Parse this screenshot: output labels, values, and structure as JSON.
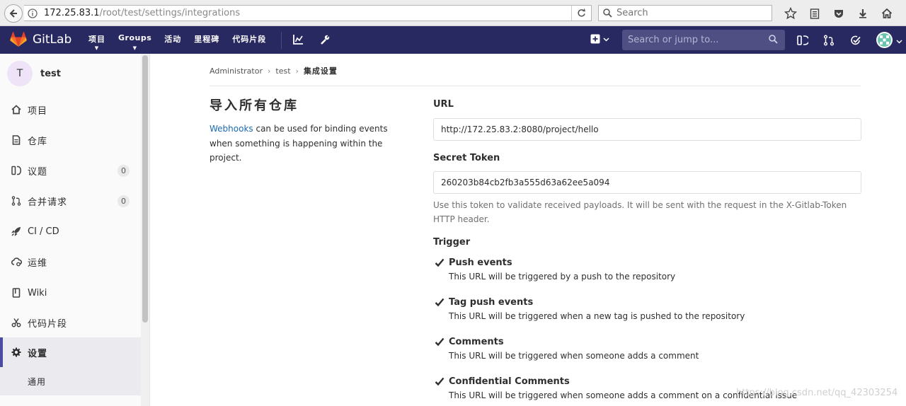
{
  "browser": {
    "url_host": "172.25.83.1",
    "url_path": "/root/test/settings/integrations",
    "search_placeholder": "Search"
  },
  "header": {
    "brand": "GitLab",
    "nav": [
      "项目",
      "Groups",
      "活动",
      "里程碑",
      "代码片段"
    ],
    "search_placeholder": "Search or jump to..."
  },
  "sidebar": {
    "project_initial": "T",
    "project_name": "test",
    "items": [
      {
        "label": "项目",
        "icon": "home-icon"
      },
      {
        "label": "仓库",
        "icon": "doc-icon"
      },
      {
        "label": "议题",
        "icon": "issues-icon",
        "count": "0"
      },
      {
        "label": "合并请求",
        "icon": "merge-icon",
        "count": "0"
      },
      {
        "label": "CI / CD",
        "icon": "rocket-icon"
      },
      {
        "label": "运维",
        "icon": "cloud-icon"
      },
      {
        "label": "Wiki",
        "icon": "book-icon"
      },
      {
        "label": "代码片段",
        "icon": "scissors-icon"
      },
      {
        "label": "设置",
        "icon": "gear-icon"
      }
    ],
    "sub_item": "通用"
  },
  "breadcrumb": {
    "items": [
      "Administrator",
      "test"
    ],
    "current": "集成设置"
  },
  "section": {
    "title": "导入所有仓库",
    "desc_link": "Webhooks",
    "desc_rest": " can be used for binding events when something is happening within the project."
  },
  "form": {
    "url_label": "URL",
    "url_value": "http://172.25.83.2:8080/project/hello",
    "token_label": "Secret Token",
    "token_value": "260203b84cb2fb3a555d63a62ee5a094",
    "token_help": "Use this token to validate received payloads. It will be sent with the request in the X-Gitlab-Token HTTP header.",
    "trigger_label": "Trigger",
    "triggers": [
      {
        "name": "Push events",
        "desc": "This URL will be triggered by a push to the repository",
        "checked": true
      },
      {
        "name": "Tag push events",
        "desc": "This URL will be triggered when a new tag is pushed to the repository",
        "checked": true
      },
      {
        "name": "Comments",
        "desc": "This URL will be triggered when someone adds a comment",
        "checked": true
      },
      {
        "name": "Confidential Comments",
        "desc": "This URL will be triggered when someone adds a comment on a confidential issue",
        "checked": true
      }
    ]
  },
  "watermark": "https://blog.csdn.net/qq_42303254"
}
